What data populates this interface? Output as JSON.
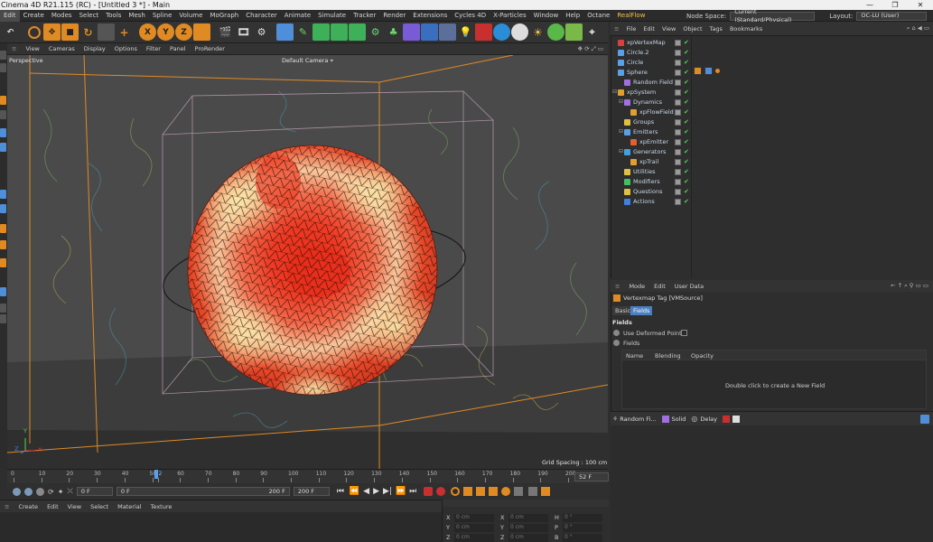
{
  "window": {
    "title": "Cinema 4D R21.115 (RC) - [Untitled 3 *] - Main",
    "controls": [
      "—",
      "❐",
      "✕"
    ]
  },
  "menubar": {
    "items": [
      "Edit",
      "Create",
      "Modes",
      "Select",
      "Tools",
      "Mesh",
      "Spline",
      "Volume",
      "MoGraph",
      "Character",
      "Animate",
      "Simulate",
      "Tracker",
      "Render",
      "Extensions",
      "Cycles 4D",
      "X-Particles",
      "Window",
      "Help",
      "Octane",
      "RealFlow"
    ],
    "node_space_label": "Node Space:",
    "node_space_value": "Current (Standard/Physical)",
    "layout_label": "Layout:",
    "layout_value": "OC-LU (User)"
  },
  "viewport": {
    "menu": [
      "View",
      "Cameras",
      "Display",
      "Options",
      "Filter",
      "Panel",
      "ProRender"
    ],
    "name": "Perspective",
    "camera": "Default Camera",
    "grid_spacing": "Grid Spacing : 100 cm",
    "axes": {
      "x": "X",
      "y": "Y",
      "z": "Z"
    }
  },
  "timeline": {
    "ticks": [
      "0",
      "10",
      "20",
      "30",
      "40",
      "50",
      "52",
      "60",
      "70",
      "80",
      "90",
      "100",
      "110",
      "120",
      "130",
      "140",
      "150",
      "160",
      "170",
      "180",
      "190",
      "200"
    ],
    "current_frame": "52 F"
  },
  "transport": {
    "start_field": "0 F",
    "min_field": "0 F",
    "max_field": "200 F",
    "end_field": "200 F"
  },
  "material_manager": {
    "menu": [
      "Create",
      "Edit",
      "View",
      "Select",
      "Material",
      "Texture"
    ]
  },
  "coordinates": {
    "rows": [
      [
        {
          "axis": "X",
          "value": "0 cm"
        },
        {
          "axis": "X",
          "value": "0 cm"
        },
        {
          "axis": "H",
          "value": "0 °"
        }
      ],
      [
        {
          "axis": "Y",
          "value": "0 cm"
        },
        {
          "axis": "Y",
          "value": "0 cm"
        },
        {
          "axis": "P",
          "value": "0 °"
        }
      ],
      [
        {
          "axis": "Z",
          "value": "0 cm"
        },
        {
          "axis": "Z",
          "value": "0 cm"
        },
        {
          "axis": "B",
          "value": "0 °"
        }
      ]
    ]
  },
  "object_manager": {
    "menu": [
      "File",
      "Edit",
      "View",
      "Object",
      "Tags",
      "Bookmarks"
    ],
    "objects": [
      {
        "label": "xpVertexMap",
        "indent": 0,
        "icon_color": "#d84040"
      },
      {
        "label": "Circle.2",
        "indent": 0,
        "icon_color": "#5aa0e6"
      },
      {
        "label": "Circle",
        "indent": 0,
        "icon_color": "#5aa0e6"
      },
      {
        "label": "Sphere",
        "indent": 0,
        "icon_color": "#5aa0e6"
      },
      {
        "label": "Random Field",
        "indent": 1,
        "icon_color": "#a070e0"
      },
      {
        "label": "xpSystem",
        "indent": 0,
        "icon_color": "#e0a030"
      },
      {
        "label": "Dynamics",
        "indent": 1,
        "icon_color": "#a070e0"
      },
      {
        "label": "xpFlowField",
        "indent": 2,
        "icon_color": "#e0a030"
      },
      {
        "label": "Groups",
        "indent": 1,
        "icon_color": "#e0c040"
      },
      {
        "label": "Emitters",
        "indent": 1,
        "icon_color": "#5aa0e6"
      },
      {
        "label": "xpEmitter",
        "indent": 2,
        "icon_color": "#e06030"
      },
      {
        "label": "Generators",
        "indent": 1,
        "icon_color": "#40a0e0"
      },
      {
        "label": "xpTrail",
        "indent": 2,
        "icon_color": "#e0a030"
      },
      {
        "label": "Utilities",
        "indent": 1,
        "icon_color": "#e0c040"
      },
      {
        "label": "Modifiers",
        "indent": 1,
        "icon_color": "#40c060"
      },
      {
        "label": "Questions",
        "indent": 1,
        "icon_color": "#e0c040"
      },
      {
        "label": "Actions",
        "indent": 1,
        "icon_color": "#4080e0"
      }
    ]
  },
  "attribute_manager": {
    "menu": [
      "Mode",
      "Edit",
      "User Data"
    ],
    "tag_title": "Vertexmap Tag [VMSource]",
    "tabs": [
      "Basic",
      "Fields"
    ],
    "section": "Fields",
    "use_deformed_points": "Use Deformed Points",
    "fields_label": "Fields",
    "columns": [
      "Name",
      "Blending",
      "Opacity"
    ],
    "empty_hint": "Double click to create a New Field"
  },
  "layers_bar": {
    "items": [
      "Random Fi...",
      "Solid",
      "Delay"
    ]
  },
  "colors": {
    "accent": "#f2c14e",
    "sphere_red": "#e82d1a",
    "sphere_yellow": "#fbe7a8",
    "frame_orange": "#e08a24",
    "check_green": "#4fd44f"
  }
}
